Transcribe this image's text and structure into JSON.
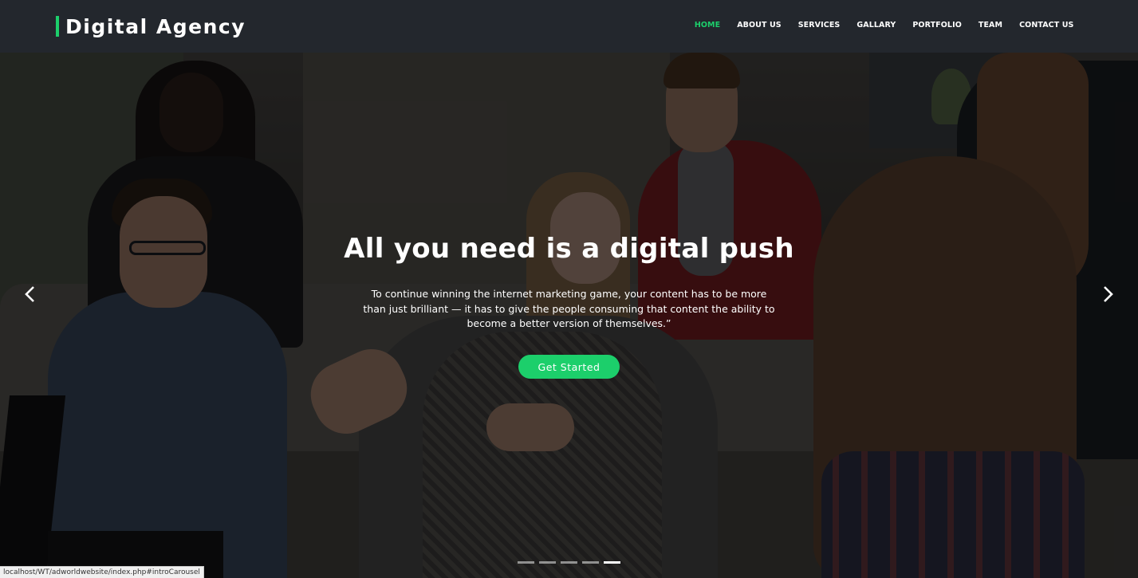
{
  "brand": {
    "name": "Digital Agency",
    "accent_color": "#1ccf6b"
  },
  "nav": {
    "items": [
      {
        "label": "HOME",
        "active": true
      },
      {
        "label": "ABOUT US",
        "active": false
      },
      {
        "label": "SERVICES",
        "active": false
      },
      {
        "label": "GALLARY",
        "active": false
      },
      {
        "label": "PORTFOLIO",
        "active": false
      },
      {
        "label": "TEAM",
        "active": false
      },
      {
        "label": "CONTACT US",
        "active": false
      }
    ]
  },
  "hero": {
    "title": "All you need is a digital push",
    "text": "To continue winning the internet marketing game, your content has to be more than just brilliant — it has to give the people consuming that content the ability to become a better version of themselves.”",
    "cta_label": "Get Started",
    "prev_icon": "chevron-left-icon",
    "next_icon": "chevron-right-icon",
    "slide_count": 5,
    "active_slide": 5
  },
  "statusbar": {
    "url": "localhost/WT/adworldwebsite/index.php#introCarousel"
  }
}
